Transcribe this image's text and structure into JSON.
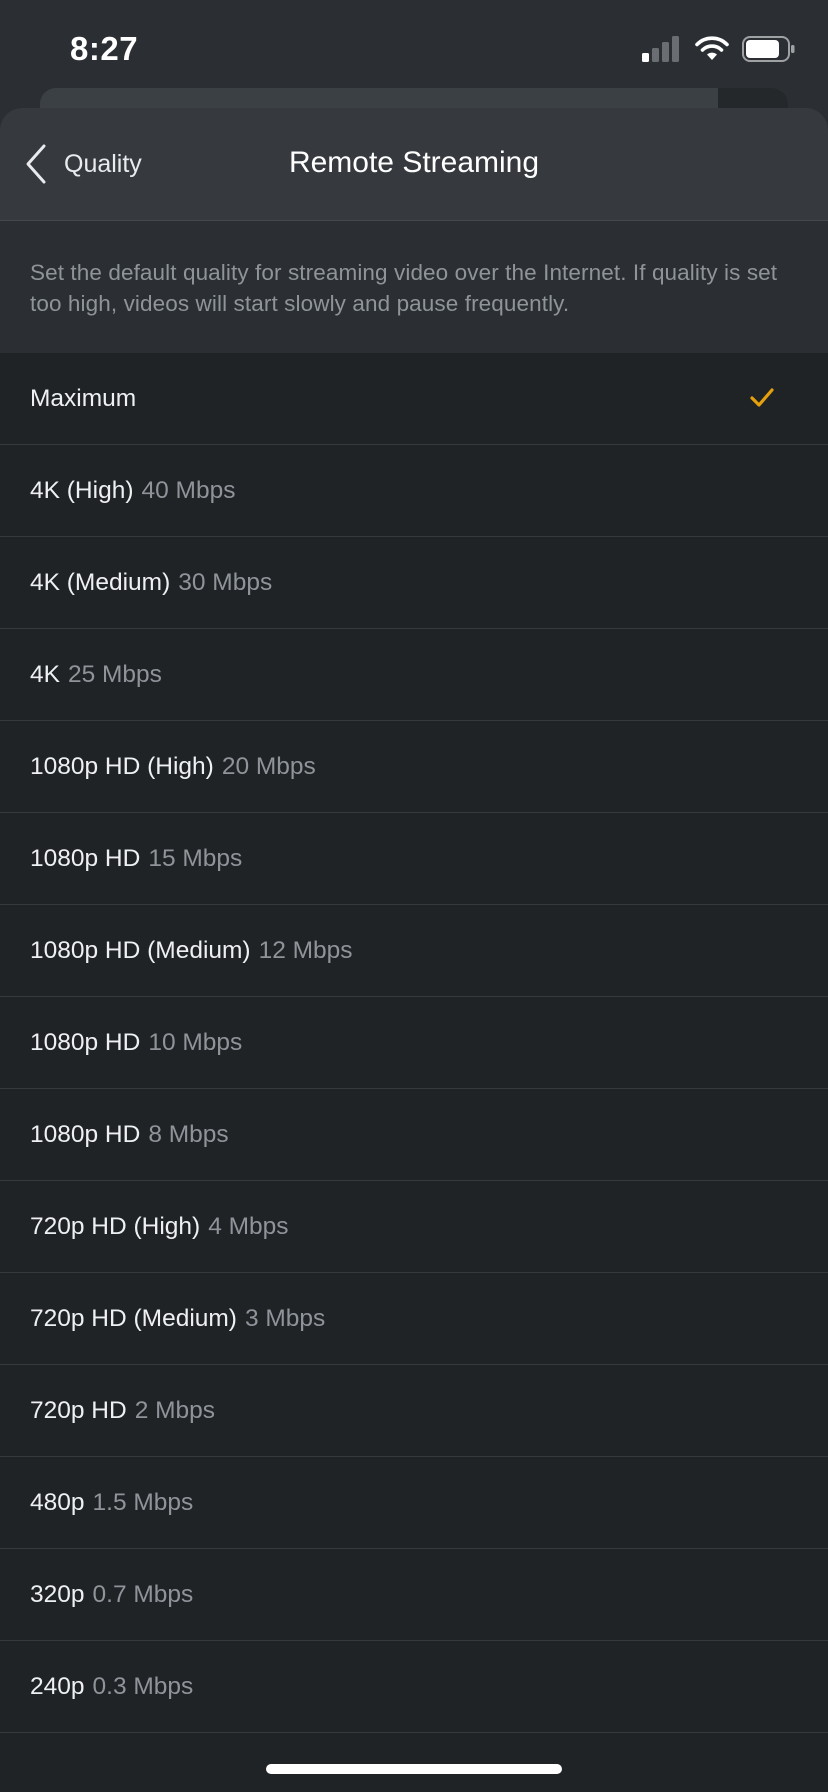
{
  "status_bar": {
    "time": "8:27"
  },
  "nav": {
    "back_label": "Quality",
    "title": "Remote Streaming"
  },
  "description": "Set the default quality for streaming video over the Internet. If quality is set too high, videos will start slowly and pause frequently.",
  "options": [
    {
      "label": "Maximum",
      "rate": "",
      "selected": true
    },
    {
      "label": "4K (High)",
      "rate": "40 Mbps",
      "selected": false
    },
    {
      "label": "4K (Medium)",
      "rate": "30 Mbps",
      "selected": false
    },
    {
      "label": "4K",
      "rate": "25 Mbps",
      "selected": false
    },
    {
      "label": "1080p HD (High)",
      "rate": "20 Mbps",
      "selected": false
    },
    {
      "label": "1080p HD",
      "rate": "15 Mbps",
      "selected": false
    },
    {
      "label": "1080p HD (Medium)",
      "rate": "12 Mbps",
      "selected": false
    },
    {
      "label": "1080p HD",
      "rate": "10 Mbps",
      "selected": false
    },
    {
      "label": "1080p HD",
      "rate": "8 Mbps",
      "selected": false
    },
    {
      "label": "720p HD (High)",
      "rate": "4 Mbps",
      "selected": false
    },
    {
      "label": "720p HD (Medium)",
      "rate": "3 Mbps",
      "selected": false
    },
    {
      "label": "720p HD",
      "rate": "2 Mbps",
      "selected": false
    },
    {
      "label": "480p",
      "rate": "1.5 Mbps",
      "selected": false
    },
    {
      "label": "320p",
      "rate": "0.7 Mbps",
      "selected": false
    },
    {
      "label": "240p",
      "rate": "0.3 Mbps",
      "selected": false
    }
  ],
  "colors": {
    "accent_check": "#e5a00d",
    "background": "#202326",
    "header": "#363a3e"
  }
}
